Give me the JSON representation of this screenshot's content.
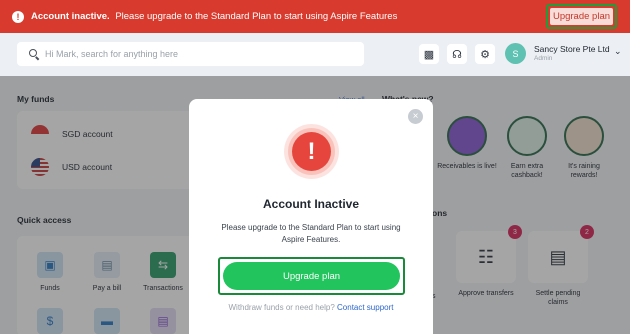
{
  "banner": {
    "title": "Account inactive.",
    "message": "Please upgrade to the Standard Plan to start using Aspire Features",
    "button": "Upgrade plan",
    "color": "#d83b2e"
  },
  "header": {
    "search_placeholder": "Hi Mark, search for anything here",
    "icons": [
      "gift-icon",
      "headset-icon",
      "gear-icon"
    ],
    "avatar_initial": "S",
    "company": "Sancy Store Pte Ltd",
    "role": "Admin"
  },
  "funds": {
    "title": "My funds",
    "view_all": "View all",
    "accounts": [
      {
        "label": "SGD account"
      },
      {
        "label": "USD account"
      }
    ]
  },
  "whats_new": {
    "title": "What's new?",
    "items": [
      {
        "label": "Receivables is live!"
      },
      {
        "label": "Earn extra cashback!"
      },
      {
        "label": "It's raining rewards!"
      }
    ]
  },
  "quick_access": {
    "title": "Quick access",
    "items": [
      {
        "label": "Funds"
      },
      {
        "label": "Pay a bill"
      },
      {
        "label": "Transactions"
      }
    ]
  },
  "tasks": {
    "section_fragment": "ons",
    "left_fragment": "s",
    "items": [
      {
        "label": "Approve transfers",
        "badge": "3"
      },
      {
        "label": "Settle pending claims",
        "badge": "2"
      }
    ]
  },
  "modal": {
    "title": "Account Inactive",
    "description": "Please upgrade to the Standard Plan to start using Aspire Features.",
    "cta": "Upgrade plan",
    "footer_text": "Withdraw funds or need help?",
    "footer_link": "Contact support",
    "cta_color": "#21c45d"
  }
}
